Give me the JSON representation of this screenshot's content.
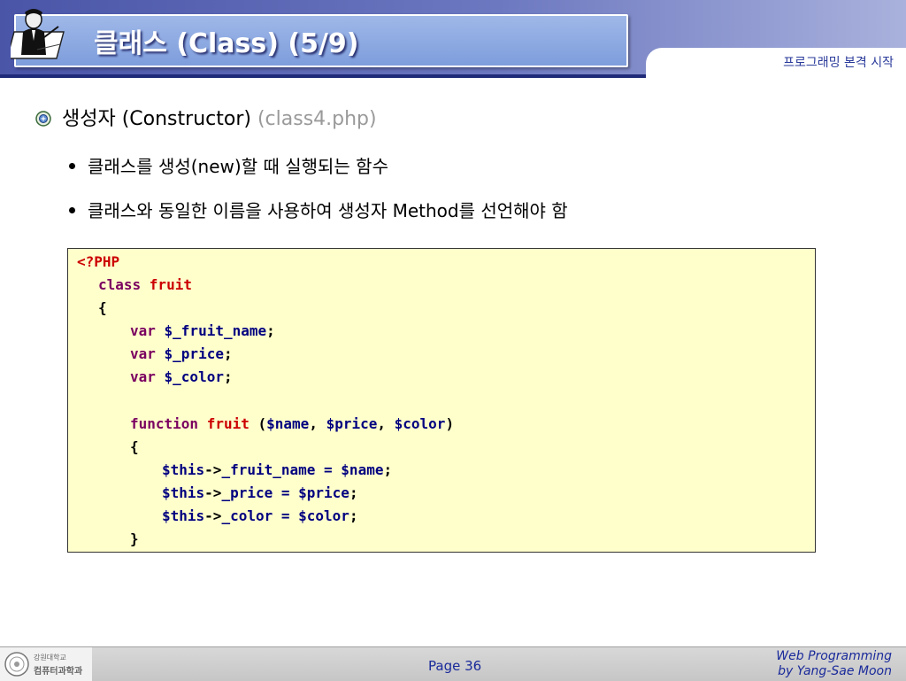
{
  "slide": {
    "title": "클래스 (Class) (5/9)",
    "subtitle": "프로그래밍 본격 시작",
    "heading": {
      "text": "생성자 (Constructor)",
      "file": "(class4.php)"
    },
    "bullets": [
      "클래스를 생성(new)할 때 실행되는 함수",
      "클래스와 동일한 이름을 사용하여 생성자 Method를 선언해야 함"
    ],
    "code": {
      "l1": "<?PHP",
      "l2_kw": "class ",
      "l2_name": "fruit",
      "l3": "{",
      "var_kw": "var ",
      "v1": "$_fruit_name",
      "v2": "$_price",
      "v3": "$_color",
      "semi": ";",
      "fn_kw": "function ",
      "fn_name": "fruit",
      "fn_open": " (",
      "p1": "$name",
      "comma": ", ",
      "p2": "$price",
      "p3": "$color",
      "fn_close": ")",
      "brace_open": "{",
      "this": "$this",
      "arrow": "->",
      "a1_prop": "_fruit_name = ",
      "a1_val": "$name",
      "a2_prop": "_price = ",
      "a2_val": "$price",
      "a3_prop": "_color = ",
      "a3_val": "$color",
      "brace_close": "}"
    },
    "footer": {
      "logo_text_top": "강원대학교",
      "logo_text_bottom": "컴퓨터과학과",
      "page": "Page 36",
      "credit_line1": "Web Programming",
      "credit_line2": "by Yang-Sae Moon"
    }
  },
  "colors": {
    "header": "#4a55a8",
    "code_bg": "#ffffcc",
    "keyword": "#7a0060",
    "name": "#cc0000",
    "variable": "#000080"
  }
}
